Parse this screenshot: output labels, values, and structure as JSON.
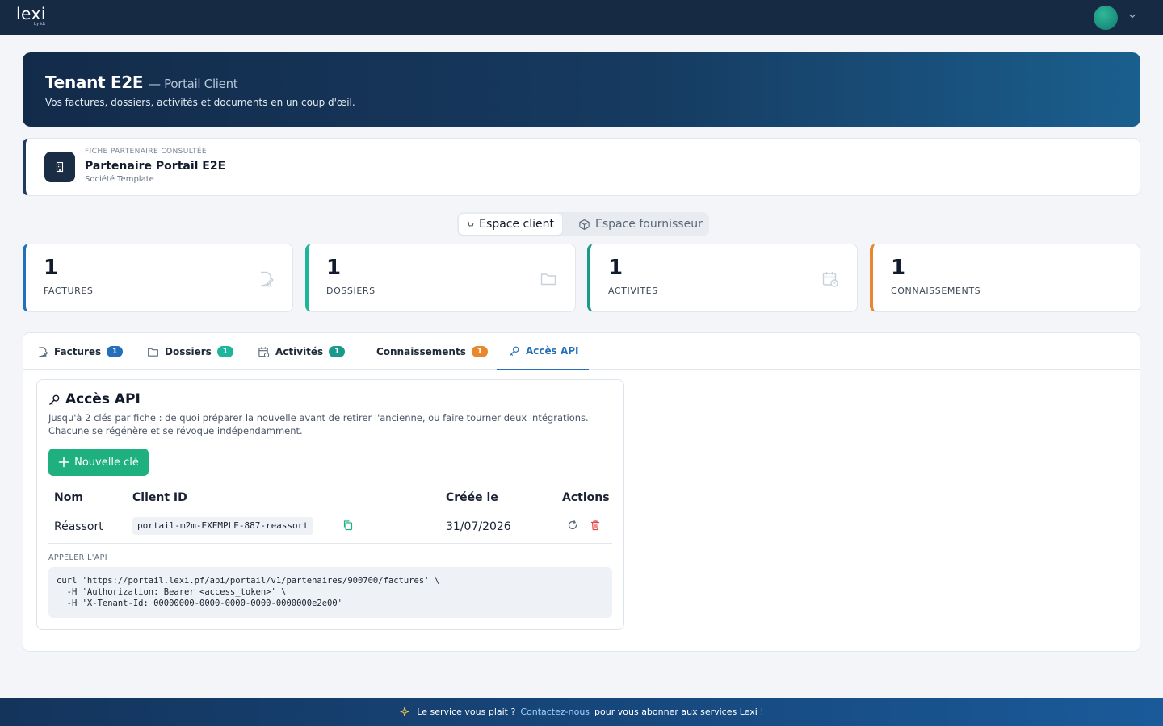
{
  "header": {
    "logo_text": "lexi",
    "logo_sub": "by idt"
  },
  "hero": {
    "title": "Tenant E2E",
    "title_suffix": "— Portail Client",
    "description": "Vos factures, dossiers, activités et documents en un coup d'œil."
  },
  "partner": {
    "overline": "FICHE PARTENAIRE CONSULTÉE",
    "name": "Partenaire Portail E2E",
    "type": "Société Template"
  },
  "spaces": {
    "client_label": "Espace client",
    "supplier_label": "Espace fournisseur"
  },
  "stats": [
    {
      "value": "1",
      "label": "FACTURES",
      "color": "#2370b8"
    },
    {
      "value": "1",
      "label": "DOSSIERS",
      "color": "#1fb59a"
    },
    {
      "value": "1",
      "label": "ACTIVITÉS",
      "color": "#1a9a8a"
    },
    {
      "value": "1",
      "label": "CONNAISSEMENTS",
      "color": "#e8872c"
    }
  ],
  "tabs": [
    {
      "label": "Factures",
      "badge": "1",
      "badge_color": "#2370b8"
    },
    {
      "label": "Dossiers",
      "badge": "1",
      "badge_color": "#1fb59a"
    },
    {
      "label": "Activités",
      "badge": "1",
      "badge_color": "#1a9a8a"
    },
    {
      "label": "Connaissements",
      "badge": "1",
      "badge_color": "#e8872c"
    },
    {
      "label": "Accès API"
    }
  ],
  "api": {
    "title": "Accès API",
    "description": "Jusqu'à 2 clés par fiche : de quoi préparer la nouvelle avant de retirer l'ancienne, ou faire tourner deux intégrations. Chacune se régénère et se révoque indépendamment.",
    "new_key_label": "Nouvelle clé",
    "columns": [
      "Nom",
      "Client ID",
      "Créée le",
      "Actions"
    ],
    "rows": [
      {
        "name": "Réassort",
        "client_id": "portail-m2m-EXEMPLE-887-reassort",
        "created": "31/07/2026"
      }
    ],
    "call_label": "APPELER L'API",
    "curl": "curl 'https://portail.lexi.pf/api/portail/v1/partenaires/900700/factures' \\\n  -H 'Authorization: Bearer <access_token>' \\\n  -H 'X-Tenant-Id: 00000000-0000-0000-0000-0000000e2e00'"
  },
  "footer": {
    "text_before": "Le service vous plait ?",
    "link": "Contactez-nous",
    "text_after": "pour vous abonner aux services Lexi !"
  }
}
